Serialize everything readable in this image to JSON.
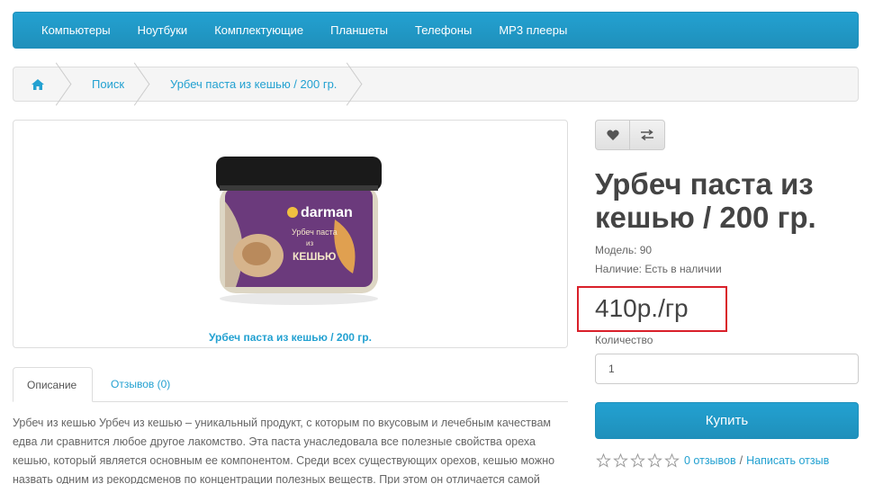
{
  "nav": {
    "items": [
      "Компьютеры",
      "Ноутбуки",
      "Комплектующие",
      "Планшеты",
      "Телефоны",
      "MP3 плееры"
    ]
  },
  "breadcrumb": {
    "home_icon": "home-icon",
    "items": [
      "Поиск",
      "Урбеч паста из кешью / 200 гр."
    ]
  },
  "product": {
    "image_caption": "Урбеч паста из кешью / 200 гр.",
    "title": "Урбеч паста из кешью / 200 гр.",
    "model": "Модель: 90",
    "availability": "Наличие: Есть в наличии",
    "price": "410р./гр",
    "qty_label": "Количество",
    "qty_value": "1",
    "buy_label": "Купить",
    "jar_brand": "darman",
    "jar_text_line1": "Урбеч паста",
    "jar_text_line2": "из",
    "jar_text_line3": "КЕШЬЮ"
  },
  "tabs": {
    "description": "Описание",
    "reviews": "Отзывов (0)"
  },
  "description": "Урбеч из кешью Урбеч из кешью – уникальный продукт, с которым по вкусовым и лечебным качествам едва ли сравнится любое другое лакомство. Эта паста унаследовала все полезные свойства ореха кешью, который является основным ее компонентом. Среди всех существующих орехов, кешью можно назвать одним из рекордсменов по концентрации полезных веществ. При этом он отличается самой",
  "rating": {
    "stars": 0,
    "reviews_link": "0 отзывов",
    "separator": "/",
    "write_link": "Написать отзыв"
  },
  "colors": {
    "accent": "#23a1d1",
    "highlight": "#d9202a"
  }
}
